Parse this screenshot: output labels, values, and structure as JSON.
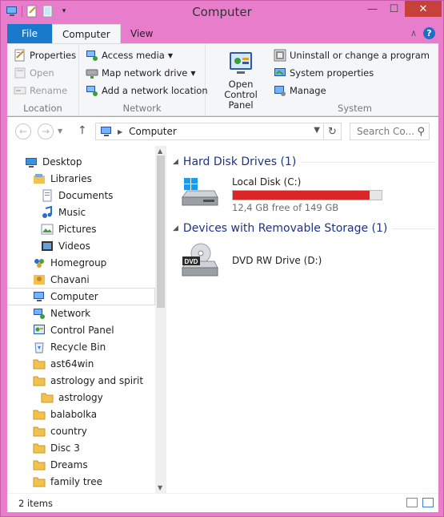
{
  "window": {
    "title": "Computer",
    "minimize": "—",
    "maximize": "☐",
    "close": "✕"
  },
  "ribbon_tabs": {
    "file": "File",
    "computer": "Computer",
    "view": "View",
    "chevron": "∧",
    "help": "?"
  },
  "ribbon": {
    "location": {
      "label": "Location",
      "properties": "Properties",
      "open": "Open",
      "rename": "Rename"
    },
    "network": {
      "label": "Network",
      "access_media": "Access media",
      "map_network_drive": "Map network drive",
      "add_network_location": "Add a network location"
    },
    "open_control_panel": "Open Control Panel",
    "system": {
      "label": "System",
      "uninstall": "Uninstall or change a program",
      "system_properties": "System properties",
      "manage": "Manage"
    }
  },
  "address": {
    "path": "Computer",
    "search_placeholder": "Search Co..."
  },
  "nav_items": [
    {
      "label": "Desktop",
      "indent": 0,
      "icon": "desktop-icon"
    },
    {
      "label": "Libraries",
      "indent": 1,
      "icon": "libraries-icon"
    },
    {
      "label": "Documents",
      "indent": 2,
      "icon": "documents-icon"
    },
    {
      "label": "Music",
      "indent": 2,
      "icon": "music-icon"
    },
    {
      "label": "Pictures",
      "indent": 2,
      "icon": "pictures-icon"
    },
    {
      "label": "Videos",
      "indent": 2,
      "icon": "videos-icon"
    },
    {
      "label": "Homegroup",
      "indent": 1,
      "icon": "homegroup-icon"
    },
    {
      "label": "Chavani",
      "indent": 1,
      "icon": "user-icon"
    },
    {
      "label": "Computer",
      "indent": 1,
      "icon": "computer-icon",
      "selected": true
    },
    {
      "label": "Network",
      "indent": 1,
      "icon": "network-icon"
    },
    {
      "label": "Control Panel",
      "indent": 1,
      "icon": "control-panel-icon"
    },
    {
      "label": "Recycle Bin",
      "indent": 1,
      "icon": "recycle-bin-icon"
    },
    {
      "label": "ast64win",
      "indent": 1,
      "icon": "folder-icon"
    },
    {
      "label": "astrology and spirit",
      "indent": 1,
      "icon": "folder-icon"
    },
    {
      "label": "astrology",
      "indent": 2,
      "icon": "folder-icon"
    },
    {
      "label": "balabolka",
      "indent": 1,
      "icon": "folder-icon"
    },
    {
      "label": "country",
      "indent": 1,
      "icon": "folder-icon"
    },
    {
      "label": "Disc 3",
      "indent": 1,
      "icon": "folder-icon"
    },
    {
      "label": "Dreams",
      "indent": 1,
      "icon": "folder-icon"
    },
    {
      "label": "family tree",
      "indent": 1,
      "icon": "folder-icon"
    }
  ],
  "content": {
    "hdd_section": "Hard Disk Drives (1)",
    "removable_section": "Devices with Removable Storage (1)",
    "local_disk": {
      "name": "Local Disk (C:)",
      "free_text": "12,4 GB free of 149 GB",
      "used_fraction": 0.917
    },
    "dvd": {
      "name": "DVD RW Drive (D:)",
      "badge": "DVD"
    }
  },
  "status": {
    "count": "2 items"
  },
  "colors": {
    "accent": "#1979ca",
    "window_frame": "#e87dcc",
    "disk_bar": "#da2626",
    "section_heading": "#1e3287"
  }
}
